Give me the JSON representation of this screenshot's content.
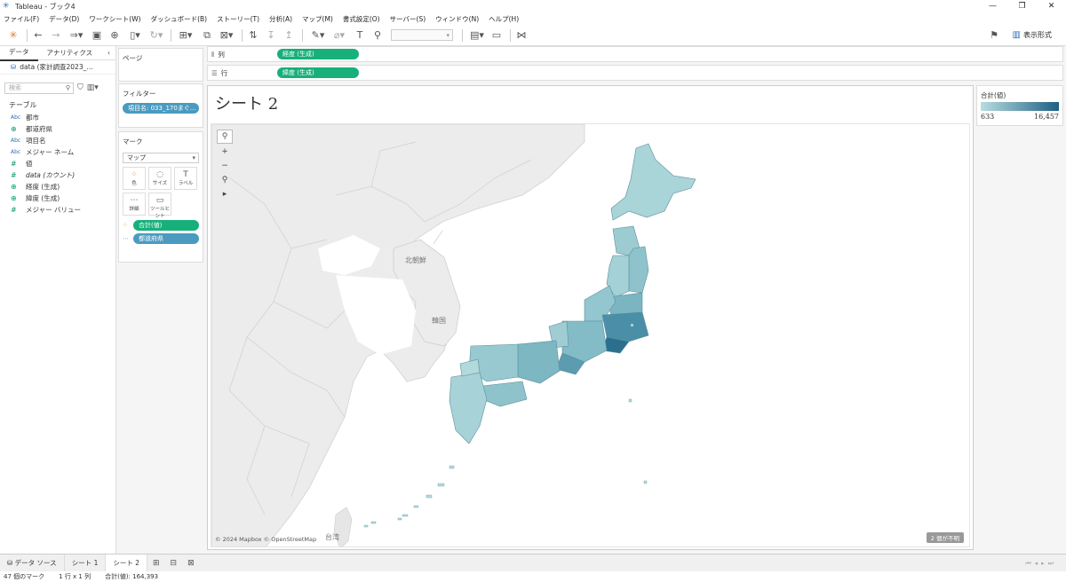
{
  "window": {
    "title": "Tableau - ブック4",
    "controls": [
      "—",
      "❐",
      "✕"
    ]
  },
  "menu": [
    "ファイル(F)",
    "データ(D)",
    "ワークシート(W)",
    "ダッシュボード(B)",
    "ストーリー(T)",
    "分析(A)",
    "マップ(M)",
    "書式設定(O)",
    "サーバー(S)",
    "ウィンドウ(N)",
    "ヘルプ(H)"
  ],
  "toolbar": {
    "show_me": "表示形式"
  },
  "left_panel": {
    "tabs": [
      "データ",
      "アナリティクス"
    ],
    "datasource": "data (家計調査2023_…",
    "search_placeholder": "検索",
    "tables_title": "テーブル",
    "fields": [
      {
        "type": "Abc",
        "name": "都市"
      },
      {
        "type": "geo",
        "name": "都道府県"
      },
      {
        "type": "Abc",
        "name": "項目名"
      },
      {
        "type": "Abc",
        "name": "メジャー ネーム"
      },
      {
        "type": "#",
        "name": "値"
      },
      {
        "type": "#",
        "name": "data (カウント)"
      },
      {
        "type": "geo",
        "name": "経度 (生成)"
      },
      {
        "type": "geo",
        "name": "緯度 (生成)"
      },
      {
        "type": "#",
        "name": "メジャー バリュー"
      }
    ]
  },
  "cards": {
    "pages": "ページ",
    "filters": {
      "title": "フィルター",
      "pill": "項目名: 033_170まぐ..."
    },
    "marks": {
      "title": "マーク",
      "type": "マップ",
      "buttons": [
        {
          "label": "色",
          "icon": "⁘"
        },
        {
          "label": "サイズ",
          "icon": "◌"
        },
        {
          "label": "ラベル",
          "icon": "T"
        },
        {
          "label": "詳細",
          "icon": "⋯"
        },
        {
          "label": "ツールヒント",
          "icon": "▭"
        }
      ],
      "pills": [
        {
          "icon": "⁘",
          "label": "合計(値)"
        },
        {
          "icon": "⋯",
          "label": "都道府県"
        }
      ]
    }
  },
  "shelves": {
    "columns": {
      "label": "列",
      "pill": "経度 (生成)"
    },
    "rows": {
      "label": "行",
      "pill": "緯度 (生成)"
    }
  },
  "sheet": {
    "title": "シート 2",
    "map_labels": {
      "north_korea": "北朝鮮",
      "korea": "韓国",
      "taiwan": "台湾"
    },
    "attribution": "© 2024 Mapbox © OpenStreetMap",
    "unknown_badge": "2 個が不明"
  },
  "legend": {
    "title": "合計(値)",
    "min": "633",
    "max": "16,457",
    "color_low": "#b8dde1",
    "color_high": "#1d5f84"
  },
  "tabs": {
    "datasource": "データ ソース",
    "sheets": [
      "シート 1",
      "シート 2"
    ],
    "active": "シート 2"
  },
  "status": {
    "marks": "47 個のマーク",
    "dims": "1 行 x 1 列",
    "sum": "合計(値): 164,393"
  }
}
